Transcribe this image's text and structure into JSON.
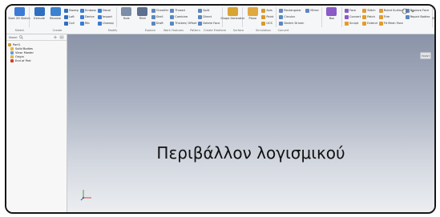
{
  "ribbon": {
    "groups": [
      {
        "name": "Sketch",
        "big": [
          {
            "label": "Start 2D Sketch",
            "icon": "sketch-icon",
            "color": "#3a7bd5"
          }
        ],
        "small": []
      },
      {
        "name": "Create",
        "big": [
          {
            "label": "Extrude",
            "icon": "extrude-icon",
            "color": "#2f6fbf"
          },
          {
            "label": "Revolve",
            "icon": "revolve-icon",
            "color": "#3d82d0"
          }
        ],
        "small": [
          {
            "label": "Sweep",
            "icon": "sweep-icon",
            "color": "#2f6fbf"
          },
          {
            "label": "Loft",
            "icon": "loft-icon",
            "color": "#2f6fbf"
          },
          {
            "label": "Coil",
            "icon": "coil-icon",
            "color": "#2f6fbf"
          },
          {
            "label": "Emboss",
            "icon": "emboss-icon",
            "color": "#3a7bd5"
          },
          {
            "label": "Derive",
            "icon": "derive-icon",
            "color": "#3a7bd5"
          },
          {
            "label": "Rib",
            "icon": "rib-icon",
            "color": "#3a7bd5"
          },
          {
            "label": "Decal",
            "icon": "decal-icon",
            "color": "#3a7bd5"
          },
          {
            "label": "Import",
            "icon": "import-icon",
            "color": "#3a7bd5"
          },
          {
            "label": "Unwrap",
            "icon": "unwrap-icon",
            "color": "#3a7bd5"
          }
        ]
      },
      {
        "name": "Modify",
        "big": [
          {
            "label": "Hole",
            "icon": "hole-icon",
            "color": "#7c8ea8"
          },
          {
            "label": "Fillet",
            "icon": "fillet-icon",
            "color": "#5d6f8f"
          }
        ],
        "small": [
          {
            "label": "Chamfer",
            "icon": "chamfer-icon",
            "color": "#5d86bf"
          },
          {
            "label": "Shell",
            "icon": "shell-icon",
            "color": "#5d86bf"
          },
          {
            "label": "Draft",
            "icon": "draft-icon",
            "color": "#5d86bf"
          },
          {
            "label": "Thread",
            "icon": "thread-icon",
            "color": "#5d86bf"
          },
          {
            "label": "Combine",
            "icon": "combine-icon",
            "color": "#5d86bf"
          },
          {
            "label": "Thicken/ Offset",
            "icon": "thicken-icon",
            "color": "#5d86bf"
          },
          {
            "label": "Split",
            "icon": "split-icon",
            "color": "#5d86bf"
          },
          {
            "label": "Direct",
            "icon": "direct-icon",
            "color": "#5d86bf"
          },
          {
            "label": "Delete Face",
            "icon": "delete-face-icon",
            "color": "#5d86bf"
          }
        ]
      },
      {
        "name": "Explore",
        "big": [
          {
            "label": "Shape Generator",
            "icon": "shape-generator-icon",
            "color": "#d8a531"
          }
        ],
        "small": []
      },
      {
        "name": "Work Features",
        "big": [
          {
            "label": "Plane",
            "icon": "plane-icon",
            "color": "#e0a840"
          }
        ],
        "small": [
          {
            "label": "Axis",
            "icon": "axis-icon",
            "color": "#d89a2a"
          },
          {
            "label": "Point",
            "icon": "point-icon",
            "color": "#d89a2a"
          },
          {
            "label": "UCS",
            "icon": "ucs-icon",
            "color": "#d89a2a"
          }
        ]
      },
      {
        "name": "Pattern",
        "big": [],
        "small": [
          {
            "label": "Rectangular",
            "icon": "rectangular-pattern-icon",
            "color": "#5d86bf"
          },
          {
            "label": "Circular",
            "icon": "circular-pattern-icon",
            "color": "#5d86bf"
          },
          {
            "label": "Sketch Driven",
            "icon": "sketch-driven-icon",
            "color": "#5d86bf"
          },
          {
            "label": "Mirror",
            "icon": "mirror-icon",
            "color": "#5d86bf"
          }
        ]
      },
      {
        "name": "Create Freeform",
        "big": [
          {
            "label": "Box",
            "icon": "box-icon",
            "color": "#8a5bc4"
          }
        ],
        "small": []
      },
      {
        "name": "Surface",
        "big": [],
        "small": [
          {
            "label": "Face",
            "icon": "face-icon",
            "color": "#8a5bc4"
          },
          {
            "label": "Convert",
            "icon": "convert-icon",
            "color": "#8a5bc4"
          },
          {
            "label": "Sculpt",
            "icon": "sculpt-icon",
            "color": "#e39b2d"
          },
          {
            "label": "Stitch",
            "icon": "stitch-icon",
            "color": "#e39b2d"
          },
          {
            "label": "Patch",
            "icon": "patch-icon",
            "color": "#e39b2d"
          },
          {
            "label": "Extend",
            "icon": "extend-icon",
            "color": "#e39b2d"
          },
          {
            "label": "Ruled Surface",
            "icon": "ruled-surface-icon",
            "color": "#e39b2d"
          },
          {
            "label": "Trim",
            "icon": "trim-icon",
            "color": "#e39b2d"
          },
          {
            "label": "Fit Mesh Face",
            "icon": "fit-mesh-face-icon",
            "color": "#e39b2d"
          },
          {
            "label": "Replace Face",
            "icon": "replace-face-icon",
            "color": "#5d86bf"
          },
          {
            "label": "Repair Bodies",
            "icon": "repair-bodies-icon",
            "color": "#5d86bf"
          }
        ]
      },
      {
        "name": "Simulation",
        "big": [
          {
            "label": "Stress Analysis",
            "icon": "stress-analysis-icon",
            "color": "#d64a3a"
          }
        ],
        "small": []
      },
      {
        "name": "Convert",
        "big": [
          {
            "label": "Convert to Sheet Metal",
            "icon": "convert-sheet-metal-icon",
            "color": "#3a8fd5"
          }
        ],
        "small": []
      }
    ]
  },
  "browser": {
    "search_placeholder": "Model",
    "items": [
      {
        "label": "Part1",
        "icon": "part-icon",
        "color": "#d39b33",
        "indent": 0
      },
      {
        "label": "Solid Bodies",
        "icon": "folder-icon",
        "color": "#e3b34a",
        "indent": 1
      },
      {
        "label": "View: Master",
        "icon": "view-icon",
        "color": "#6a9bd8",
        "indent": 1
      },
      {
        "label": "Origin",
        "icon": "origin-icon",
        "color": "#e3b34a",
        "indent": 1
      },
      {
        "label": "End of Part",
        "icon": "end-of-part-icon",
        "color": "#d23b2d",
        "indent": 1
      }
    ]
  },
  "viewport": {
    "overlay_text": "Περιβάλλον λογισμικού",
    "viewcube_label": "FRONT"
  }
}
